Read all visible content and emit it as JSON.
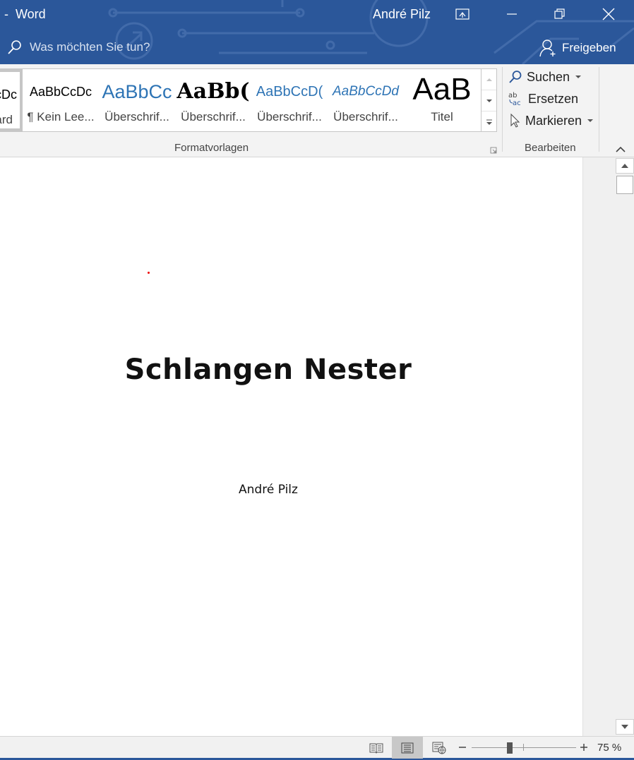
{
  "titlebar": {
    "app_title": "-  Word",
    "user_name": "André Pilz",
    "tell_me_placeholder": "Was möchten Sie tun?",
    "share_label": "Freigeben",
    "background_color": "#2b579a"
  },
  "ribbon": {
    "styles_group_label": "Formatvorlagen",
    "edit_group_label": "Bearbeiten",
    "styles": [
      {
        "sample": "aBbCcDc",
        "name": "¶ Standard"
      },
      {
        "sample": "AaBbCcDc",
        "name": "¶ Kein Lee..."
      },
      {
        "sample": "AaBbCc",
        "name": "Überschrif..."
      },
      {
        "sample": "AaBb(",
        "name": "Überschrif..."
      },
      {
        "sample": "AaBbCcD(",
        "name": "Überschrif..."
      },
      {
        "sample": "AaBbCcDd",
        "name": "Überschrif..."
      },
      {
        "sample": "AaB",
        "name": "Titel"
      }
    ],
    "edit": {
      "search_label": "Suchen",
      "replace_label": "Ersetzen",
      "select_label": "Markieren"
    }
  },
  "document": {
    "title": "Schlangen Nester",
    "author": "André Pilz"
  },
  "statusbar": {
    "zoom_level": "75 %",
    "zoom_percent": 75,
    "active_view": "print-layout"
  }
}
